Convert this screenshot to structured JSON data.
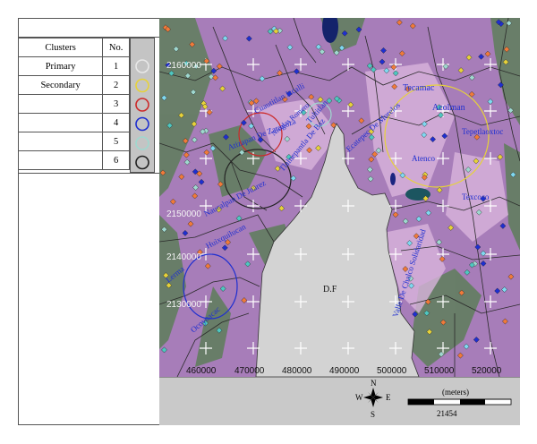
{
  "legend": {
    "header_clusters": "Clusters",
    "header_no": "No.",
    "rows": [
      {
        "cluster": "Primary",
        "no": "1",
        "color": "#e8e8e8"
      },
      {
        "cluster": "Secondary",
        "no": "2",
        "color": "#e6d23a"
      },
      {
        "cluster": "",
        "no": "3",
        "color": "#cc2a2a"
      },
      {
        "cluster": "",
        "no": "4",
        "color": "#1f2fd0"
      },
      {
        "cluster": "",
        "no": "5",
        "color": "#9fd8cf"
      },
      {
        "cluster": "",
        "no": "6",
        "color": "#222222"
      }
    ]
  },
  "map": {
    "northing_labels": [
      "2160000",
      "2150000",
      "2140000",
      "2130000"
    ],
    "easting_labels": [
      "460000",
      "470000",
      "480000",
      "490000",
      "500000",
      "510000",
      "520000"
    ],
    "center_label": "D.F",
    "place_names": [
      {
        "name": "Tecamac"
      },
      {
        "name": "Acolman"
      },
      {
        "name": "Tepetlaoxtoc"
      },
      {
        "name": "Atenco"
      },
      {
        "name": "Texcoco"
      },
      {
        "name": "Cuautitlan Izcalli"
      },
      {
        "name": "Tultitlan"
      },
      {
        "name": "Atizapan De Zaragoza"
      },
      {
        "name": "Tlalnepantla De Baz"
      },
      {
        "name": "Ecatepec De Morelos"
      },
      {
        "name": "Nicolas Romero"
      },
      {
        "name": "Naucalpan De Juarez"
      },
      {
        "name": "Huixquilucan"
      },
      {
        "name": "Lerma"
      },
      {
        "name": "Ocoyoacac"
      },
      {
        "name": "Valle De Chalco Solidaridad"
      }
    ]
  },
  "compass": {
    "n": "N",
    "s": "S",
    "e": "E",
    "w": "W"
  },
  "scale": {
    "unit": "(meters)",
    "value": "21454"
  }
}
